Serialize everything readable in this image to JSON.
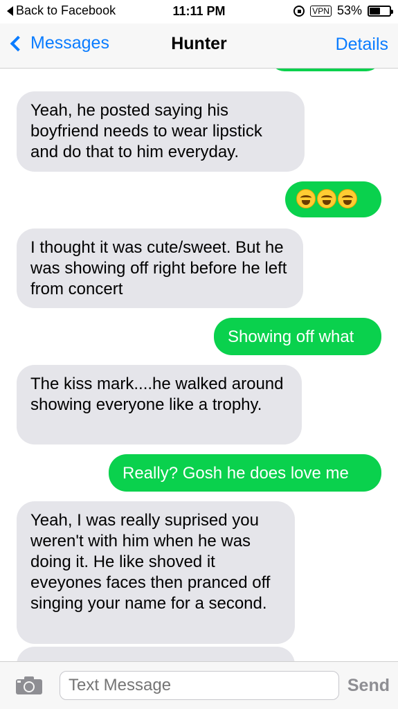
{
  "status_bar": {
    "back_text": "Back to Facebook",
    "time": "11:11 PM",
    "vpn": "VPN",
    "battery": "53%",
    "battery_level": 0.53
  },
  "nav": {
    "back_label": "Messages",
    "title": "Hunter",
    "details_label": "Details"
  },
  "messages": [
    {
      "from": "recv",
      "text": "Yeah, he posted saying his boyfriend needs to wear lipstick and do that to him everyday."
    },
    {
      "from": "sent",
      "text": "😂😂😂"
    },
    {
      "from": "recv",
      "text": "I thought it was cute/sweet. But he was showing off right before he left from concert"
    },
    {
      "from": "sent",
      "text": "Showing off what"
    },
    {
      "from": "recv",
      "text": "The kiss mark....he walked around showing everyone like a trophy."
    },
    {
      "from": "sent",
      "text": "Really? Gosh he does love me"
    },
    {
      "from": "recv",
      "text": "Yeah, I was really suprised you weren't with him when he was doing it. He like shoved it eveyones faces then pranced off singing your name for a second."
    }
  ],
  "input": {
    "placeholder": "Text Message",
    "send_label": "Send"
  },
  "colors": {
    "sent_bubble": "#0ad14d",
    "received_bubble": "#e5e5ea",
    "accent": "#0a7cff"
  }
}
